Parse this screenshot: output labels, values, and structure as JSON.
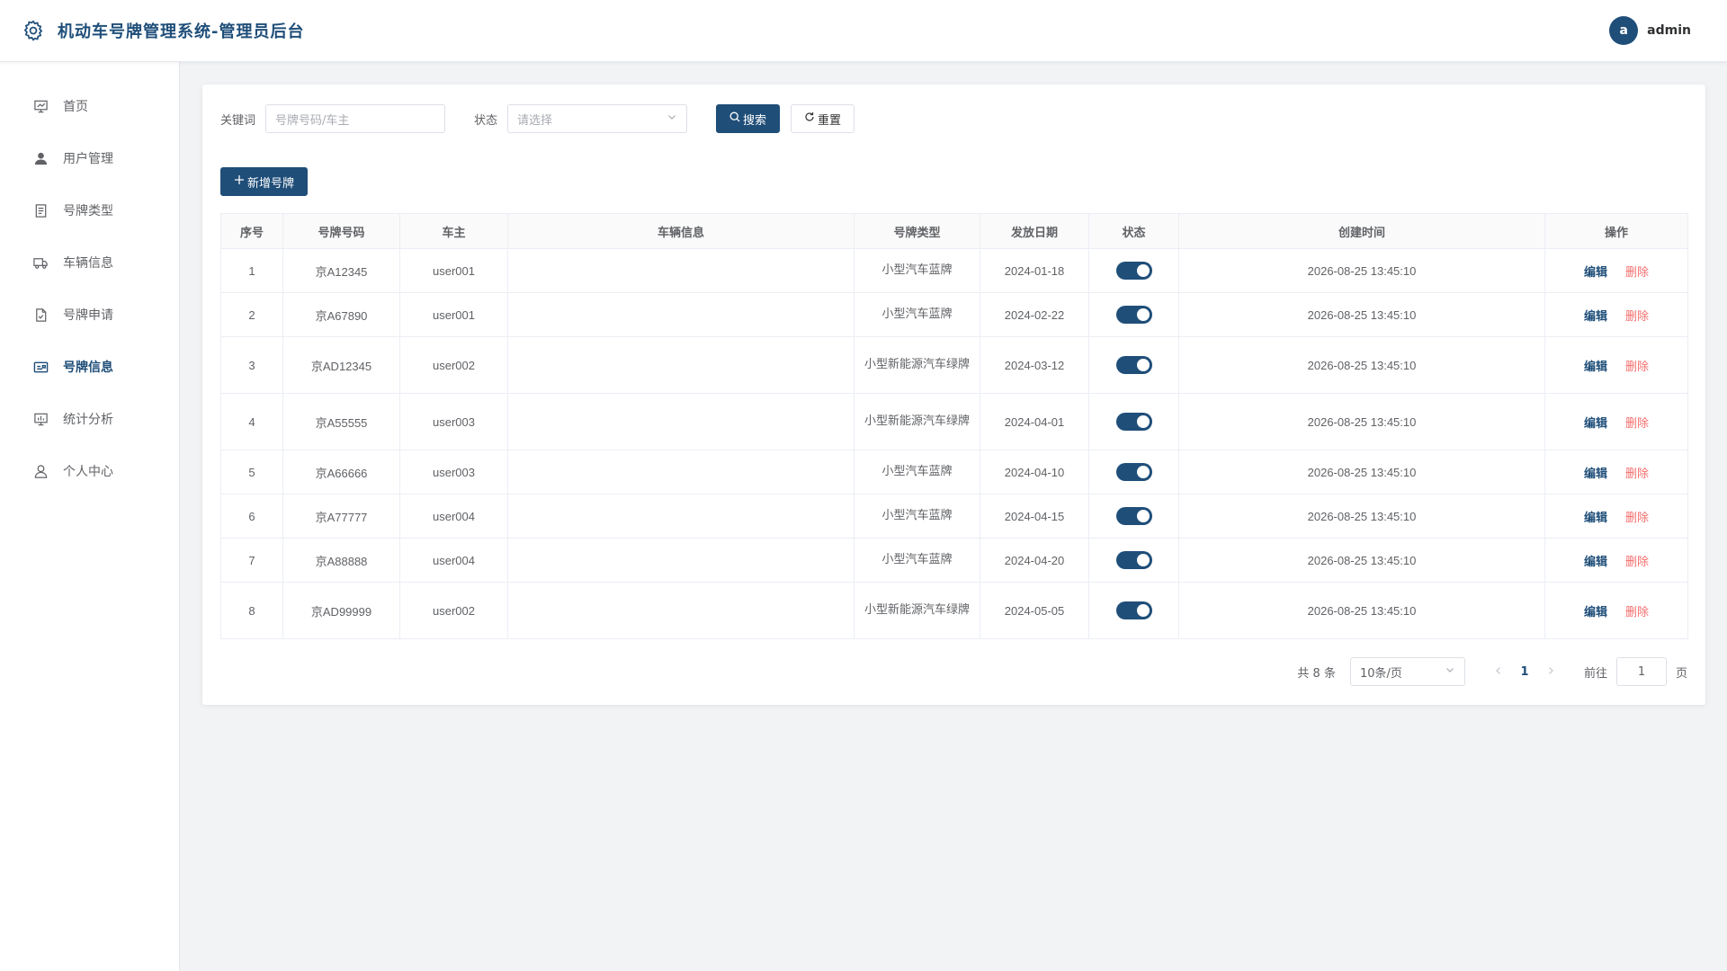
{
  "header": {
    "title": "机动车号牌管理系统-管理员后台",
    "user": {
      "avatar_letter": "a",
      "name": "admin"
    }
  },
  "sidebar": {
    "items": [
      {
        "label": "首页",
        "icon": "home-board-icon"
      },
      {
        "label": "用户管理",
        "icon": "user-icon"
      },
      {
        "label": "号牌类型",
        "icon": "document-icon"
      },
      {
        "label": "车辆信息",
        "icon": "truck-icon"
      },
      {
        "label": "号牌申请",
        "icon": "file-check-icon"
      },
      {
        "label": "号牌信息",
        "icon": "card-icon",
        "active": true
      },
      {
        "label": "统计分析",
        "icon": "chart-board-icon"
      },
      {
        "label": "个人中心",
        "icon": "person-icon"
      }
    ]
  },
  "filters": {
    "keyword_label": "关键词",
    "keyword_placeholder": "号牌号码/车主",
    "status_label": "状态",
    "status_placeholder": "请选择",
    "search_label": "搜索",
    "reset_label": "重置"
  },
  "toolbar": {
    "add_label": "新增号牌"
  },
  "table": {
    "columns": [
      "序号",
      "号牌号码",
      "车主",
      "车辆信息",
      "号牌类型",
      "发放日期",
      "状态",
      "创建时间",
      "操作"
    ],
    "action_edit": "编辑",
    "action_delete": "删除",
    "rows": [
      {
        "index": "1",
        "plate": "京A12345",
        "owner": "user001",
        "vehicle": "",
        "type": "小型汽车蓝牌",
        "date": "2024-01-18",
        "enabled": true,
        "created": "2026-08-25 13:45:10"
      },
      {
        "index": "2",
        "plate": "京A67890",
        "owner": "user001",
        "vehicle": "",
        "type": "小型汽车蓝牌",
        "date": "2024-02-22",
        "enabled": true,
        "created": "2026-08-25 13:45:10"
      },
      {
        "index": "3",
        "plate": "京AD12345",
        "owner": "user002",
        "vehicle": "",
        "type": "小型新能源汽车绿牌",
        "date": "2024-03-12",
        "enabled": true,
        "created": "2026-08-25 13:45:10"
      },
      {
        "index": "4",
        "plate": "京A55555",
        "owner": "user003",
        "vehicle": "",
        "type": "小型新能源汽车绿牌",
        "date": "2024-04-01",
        "enabled": true,
        "created": "2026-08-25 13:45:10"
      },
      {
        "index": "5",
        "plate": "京A66666",
        "owner": "user003",
        "vehicle": "",
        "type": "小型汽车蓝牌",
        "date": "2024-04-10",
        "enabled": true,
        "created": "2026-08-25 13:45:10"
      },
      {
        "index": "6",
        "plate": "京A77777",
        "owner": "user004",
        "vehicle": "",
        "type": "小型汽车蓝牌",
        "date": "2024-04-15",
        "enabled": true,
        "created": "2026-08-25 13:45:10"
      },
      {
        "index": "7",
        "plate": "京A88888",
        "owner": "user004",
        "vehicle": "",
        "type": "小型汽车蓝牌",
        "date": "2024-04-20",
        "enabled": true,
        "created": "2026-08-25 13:45:10"
      },
      {
        "index": "8",
        "plate": "京AD99999",
        "owner": "user002",
        "vehicle": "",
        "type": "小型新能源汽车绿牌",
        "date": "2024-05-05",
        "enabled": true,
        "created": "2026-08-25 13:45:10"
      }
    ]
  },
  "pagination": {
    "total_text": "共 8 条",
    "page_size": "10条/页",
    "current_page": "1",
    "goto_prefix": "前往",
    "goto_value": "1",
    "goto_suffix": "页"
  },
  "colors": {
    "primary": "#1f4e79",
    "danger": "#f56c6c",
    "background": "#f2f3f5"
  }
}
